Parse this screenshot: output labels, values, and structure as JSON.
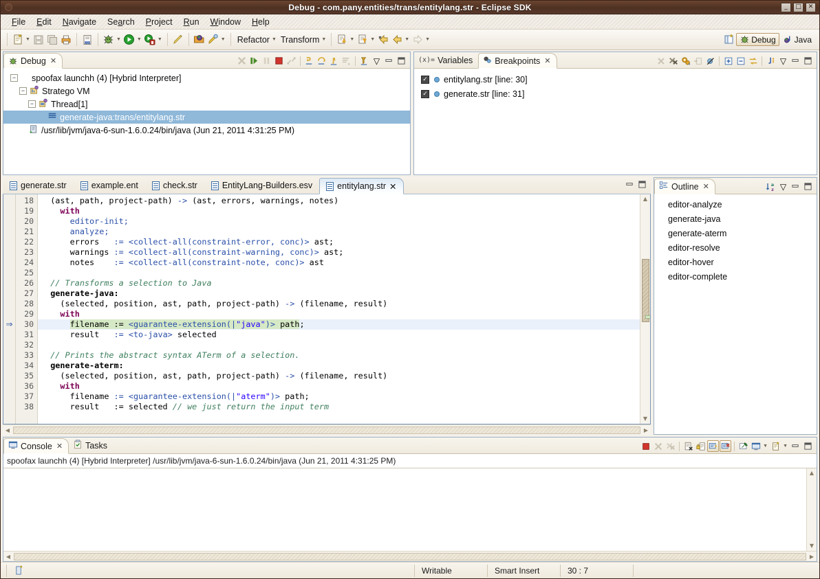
{
  "window": {
    "title": "Debug - com.pany.entities/trans/entitylang.str - Eclipse SDK",
    "minimize": "_",
    "maximize": "□",
    "close": "✕"
  },
  "menubar": {
    "items": [
      "File",
      "Edit",
      "Navigate",
      "Search",
      "Project",
      "Run",
      "Window",
      "Help"
    ]
  },
  "toolbar": {
    "refactor_label": "Refactor",
    "transform_label": "Transform",
    "items": [
      {
        "name": "new-wizard",
        "glyph": "📄"
      },
      {
        "name": "save",
        "glyph": "💾"
      },
      {
        "name": "save-all",
        "glyph": "🗐"
      },
      {
        "name": "print",
        "glyph": "🖨"
      },
      {
        "name": "toggle-binary",
        "glyph": "010"
      },
      {
        "name": "debug",
        "glyph": "🐞"
      },
      {
        "name": "run",
        "glyph": "▶"
      },
      {
        "name": "external-tools",
        "glyph": "⚙"
      },
      {
        "name": "marker",
        "glyph": "🖊"
      },
      {
        "name": "open-type",
        "glyph": "🔍"
      },
      {
        "name": "search",
        "glyph": "🔎"
      }
    ],
    "perspectives": [
      {
        "label": "Debug",
        "active": true
      },
      {
        "label": "Java",
        "active": false
      }
    ]
  },
  "debug_view": {
    "tab_label": "Debug",
    "tree": [
      {
        "label": "spoofax launchh (4) [Hybrid Interpreter]",
        "indent": 0,
        "expander": "-",
        "icon": "",
        "selected": false
      },
      {
        "label": "Stratego VM",
        "indent": 1,
        "expander": "-",
        "icon": "vm",
        "selected": false
      },
      {
        "label": "Thread[1]",
        "indent": 2,
        "expander": "-",
        "icon": "thread",
        "selected": false
      },
      {
        "label": "generate-java:trans/entitylang.str",
        "indent": 3,
        "expander": "",
        "icon": "frame",
        "selected": true
      },
      {
        "label": "/usr/lib/jvm/java-6-sun-1.6.0.24/bin/java (Jun 21, 2011 4:31:25 PM)",
        "indent": 2,
        "expander": "",
        "icon": "process",
        "selected": false
      }
    ]
  },
  "breakpoints_view": {
    "tabs": [
      {
        "label": "Variables",
        "active": false
      },
      {
        "label": "Breakpoints",
        "active": true
      }
    ],
    "rows": [
      {
        "label": "entitylang.str [line: 30]",
        "checked": true
      },
      {
        "label": "generate.str [line: 31]",
        "checked": true
      }
    ]
  },
  "editor": {
    "tabs": [
      {
        "label": "generate.str",
        "active": false
      },
      {
        "label": "example.ent",
        "active": false
      },
      {
        "label": "check.str",
        "active": false
      },
      {
        "label": "EntityLang-Builders.esv",
        "active": false
      },
      {
        "label": "entitylang.str",
        "active": true
      }
    ],
    "first_line": 18,
    "current_line": 30,
    "lines": [
      {
        "n": 18,
        "segments": [
          {
            "t": "  (ast, path, project-path) ",
            "c": "plain"
          },
          {
            "t": "->",
            "c": "call"
          },
          {
            "t": " (ast, errors, warnings, notes)",
            "c": "plain"
          }
        ]
      },
      {
        "n": 19,
        "segments": [
          {
            "t": "    ",
            "c": "plain"
          },
          {
            "t": "with",
            "c": "kw"
          }
        ]
      },
      {
        "n": 20,
        "segments": [
          {
            "t": "      ",
            "c": "plain"
          },
          {
            "t": "editor-init;",
            "c": "call"
          }
        ]
      },
      {
        "n": 21,
        "segments": [
          {
            "t": "      ",
            "c": "plain"
          },
          {
            "t": "analyze;",
            "c": "call"
          }
        ]
      },
      {
        "n": 22,
        "segments": [
          {
            "t": "      errors   ",
            "c": "plain"
          },
          {
            "t": ":= <collect-all(constraint-error, conc)>",
            "c": "call"
          },
          {
            "t": " ast;",
            "c": "plain"
          }
        ]
      },
      {
        "n": 23,
        "segments": [
          {
            "t": "      warnings ",
            "c": "plain"
          },
          {
            "t": ":= <collect-all(constraint-warning, conc)>",
            "c": "call"
          },
          {
            "t": " ast;",
            "c": "plain"
          }
        ]
      },
      {
        "n": 24,
        "segments": [
          {
            "t": "      notes    ",
            "c": "plain"
          },
          {
            "t": ":= <collect-all(constraint-note, conc)>",
            "c": "call"
          },
          {
            "t": " ast",
            "c": "plain"
          }
        ]
      },
      {
        "n": 25,
        "segments": []
      },
      {
        "n": 26,
        "segments": [
          {
            "t": "  // Transforms a selection to Java",
            "c": "cmt"
          }
        ]
      },
      {
        "n": 27,
        "segments": [
          {
            "t": "  generate-java:",
            "c": "strat"
          }
        ]
      },
      {
        "n": 28,
        "segments": [
          {
            "t": "    (selected, position, ast, path, project-path) ",
            "c": "plain"
          },
          {
            "t": "->",
            "c": "call"
          },
          {
            "t": " (filename, result)",
            "c": "plain"
          }
        ]
      },
      {
        "n": 29,
        "segments": [
          {
            "t": "    ",
            "c": "plain"
          },
          {
            "t": "with",
            "c": "kw"
          }
        ]
      },
      {
        "n": 30,
        "segments": [
          {
            "t": "      ",
            "c": "plain"
          },
          {
            "t": "filename := ",
            "c": "hl-plain"
          },
          {
            "t": "<guarantee-extension(|",
            "c": "hl-call"
          },
          {
            "t": "\"java\"",
            "c": "hl-str"
          },
          {
            "t": ")>",
            "c": "hl-call"
          },
          {
            "t": " path",
            "c": "hl-plain"
          },
          {
            "t": ";",
            "c": "plain"
          }
        ]
      },
      {
        "n": 31,
        "segments": [
          {
            "t": "      result   ",
            "c": "plain"
          },
          {
            "t": ":= <to-java>",
            "c": "call"
          },
          {
            "t": " selected",
            "c": "plain"
          }
        ]
      },
      {
        "n": 32,
        "segments": []
      },
      {
        "n": 33,
        "segments": [
          {
            "t": "  // Prints the abstract syntax ATerm of a selection.",
            "c": "cmt"
          }
        ]
      },
      {
        "n": 34,
        "segments": [
          {
            "t": "  generate-aterm:",
            "c": "strat"
          }
        ]
      },
      {
        "n": 35,
        "segments": [
          {
            "t": "    (selected, position, ast, path, project-path) ",
            "c": "plain"
          },
          {
            "t": "->",
            "c": "call"
          },
          {
            "t": " (filename, result)",
            "c": "plain"
          }
        ]
      },
      {
        "n": 36,
        "segments": [
          {
            "t": "    ",
            "c": "plain"
          },
          {
            "t": "with",
            "c": "kw"
          }
        ]
      },
      {
        "n": 37,
        "segments": [
          {
            "t": "      filename ",
            "c": "plain"
          },
          {
            "t": ":= <guarantee-extension(|",
            "c": "call"
          },
          {
            "t": "\"aterm\"",
            "c": "str"
          },
          {
            "t": ")>",
            "c": "call"
          },
          {
            "t": " path;",
            "c": "plain"
          }
        ]
      },
      {
        "n": 38,
        "segments": [
          {
            "t": "      result   := selected ",
            "c": "plain"
          },
          {
            "t": "// we just return the input term",
            "c": "cmt"
          }
        ]
      }
    ]
  },
  "outline_view": {
    "tab_label": "Outline",
    "items": [
      "editor-analyze",
      "generate-java",
      "generate-aterm",
      "editor-resolve",
      "editor-hover",
      "editor-complete"
    ]
  },
  "console_view": {
    "tabs": [
      {
        "label": "Console",
        "active": true
      },
      {
        "label": "Tasks",
        "active": false
      }
    ],
    "header": "spoofax launchh (4) [Hybrid Interpreter] /usr/lib/jvm/java-6-sun-1.6.0.24/bin/java (Jun 21, 2011 4:31:25 PM)",
    "body": ""
  },
  "statusbar": {
    "writable": "Writable",
    "insert_mode": "Smart Insert",
    "position": "30 : 7"
  },
  "colors": {
    "title_bar": "#4e3122",
    "selection": "#8fb8d9",
    "current_line": "#eaf1fb",
    "occurrence_highlight": "#d6e9c6",
    "keyword": "#7c0055",
    "comment": "#3f7f5f",
    "string": "#2a00ff",
    "call": "#2a4fa8"
  }
}
